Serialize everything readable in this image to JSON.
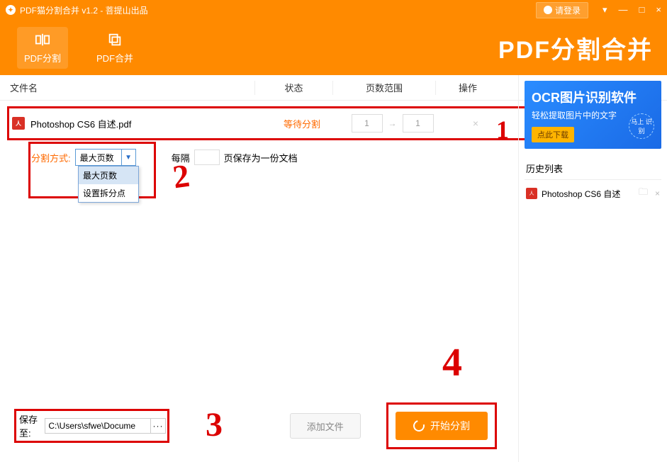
{
  "titlebar": {
    "title": "PDF猫分割合并 v1.2 - 菩提山出品",
    "login": "请登录"
  },
  "header": {
    "tab_split": "PDF分割",
    "tab_merge": "PDF合并",
    "brand": "PDF分割合并"
  },
  "columns": {
    "filename": "文件名",
    "status": "状态",
    "range": "页数范围",
    "action": "操作"
  },
  "file": {
    "name": "Photoshop CS6 自述.pdf",
    "status": "等待分割",
    "page_from": "1",
    "page_to": "1"
  },
  "options": {
    "method_label": "分割方式:",
    "method_value": "最大页数",
    "dropdown_opt1": "最大页数",
    "dropdown_opt2": "设置拆分点",
    "every_label": "每隔",
    "every_value": "",
    "every_suffix": "页保存为一份文档"
  },
  "footer": {
    "save_label": "保存至:",
    "save_path": "C:\\Users\\sfwe\\Docume",
    "add_file": "添加文件",
    "start": "开始分割"
  },
  "sidebar": {
    "promo_title": "OCR图片识别软件",
    "promo_sub": "轻松提取图片中的文字",
    "promo_btn": "点此下载",
    "promo_badge": "马上\n识别",
    "history_title": "历史列表",
    "history_item": "Photoshop CS6 自述"
  },
  "annotations": {
    "n1": "1",
    "n2": "2",
    "n3": "3",
    "n4": "4"
  }
}
